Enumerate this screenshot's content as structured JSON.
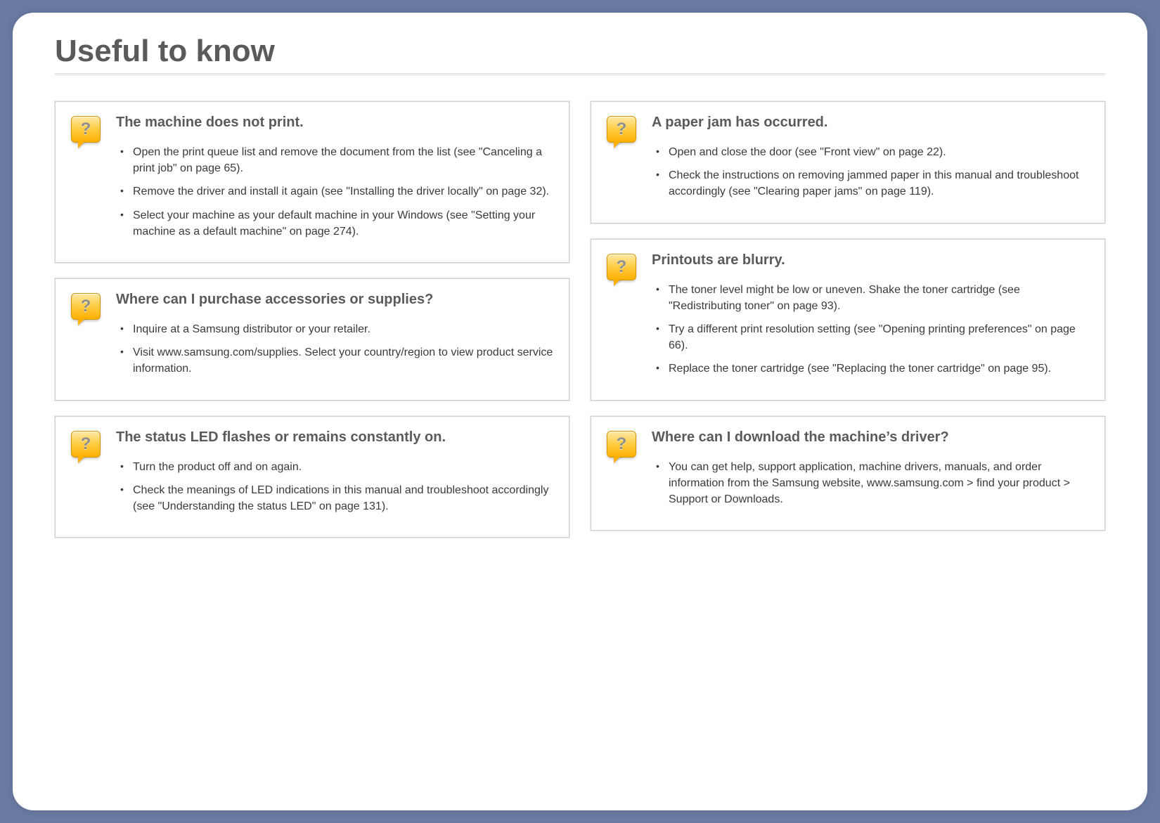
{
  "page": {
    "title": "Useful to know"
  },
  "columns": [
    {
      "cards": [
        {
          "title": "The machine does not print.",
          "items": [
            "Open the print queue list and remove the document from the list (see \"Canceling a print job\" on page 65).",
            "Remove the driver and install it again (see \"Installing the driver locally\" on page 32).",
            "Select your machine as your default machine in your Windows (see \"Setting your machine as a default machine\" on page 274)."
          ]
        },
        {
          "title": "Where can I purchase accessories or supplies?",
          "items": [
            "Inquire at a Samsung distributor or your retailer.",
            "Visit www.samsung.com/supplies. Select your country/region to view product service information."
          ]
        },
        {
          "title": "The status LED flashes or remains constantly on.",
          "items": [
            "Turn the product off and on again.",
            "Check the meanings of LED indications in this manual and troubleshoot accordingly (see \"Understanding the status LED\" on page 131)."
          ]
        }
      ]
    },
    {
      "cards": [
        {
          "title": "A paper jam has occurred.",
          "items": [
            "Open and close the door (see \"Front view\" on page 22).",
            "Check the instructions on removing jammed paper in this manual and troubleshoot accordingly (see \"Clearing paper jams\" on page 119)."
          ]
        },
        {
          "title": "Printouts are blurry.",
          "items": [
            "The toner level might be low or uneven. Shake the toner cartridge (see \"Redistributing toner\" on page 93).",
            "Try a different print resolution setting (see \"Opening printing preferences\" on page 66).",
            "Replace the toner cartridge (see \"Replacing the toner cartridge\" on page 95)."
          ]
        },
        {
          "title": "Where can I download the machine’s driver?",
          "items": [
            "You can get help, support application, machine drivers, manuals, and order information from the Samsung website, www.samsung.com > find your product > Support or Downloads."
          ]
        }
      ]
    }
  ]
}
